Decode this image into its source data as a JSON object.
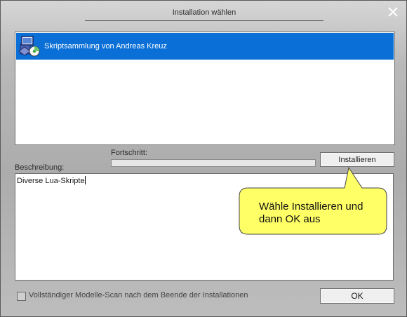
{
  "window": {
    "title": "Installation wählen",
    "close_icon": "close-x-icon"
  },
  "package_list": {
    "items": [
      {
        "label": "Skriptsammlung von Andreas Kreuz",
        "icon": "install-package-icon",
        "selected": true
      }
    ]
  },
  "progress": {
    "label": "Fortschritt:",
    "value": 0
  },
  "install_button": {
    "label": "Installieren"
  },
  "description": {
    "label": "Beschreibung:",
    "value": "Diverse Lua-Skripte"
  },
  "callout": {
    "text": "Wähle Installieren und dann OK aus",
    "color": "#ffff66"
  },
  "full_scan": {
    "label": "Vollständiger Modelle-Scan nach dem Beende der Installationen",
    "checked": false
  },
  "ok_button": {
    "label": "OK"
  },
  "colors": {
    "selection": "#0a6fd6",
    "window_bg": "#b9b9b9"
  }
}
